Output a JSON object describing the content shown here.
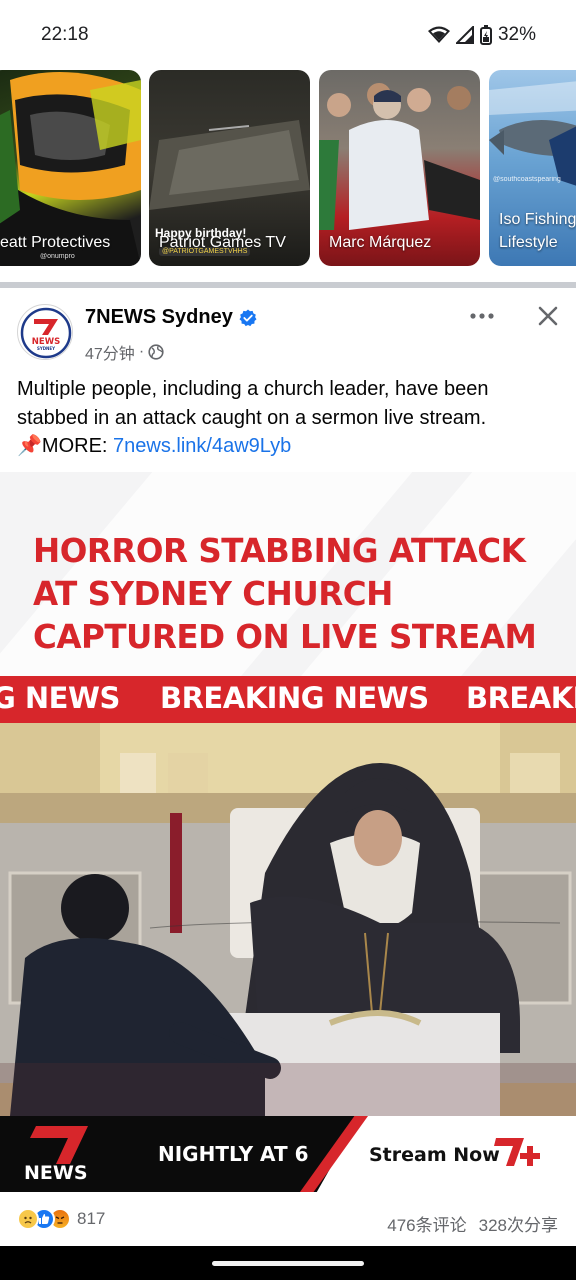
{
  "status_bar": {
    "time": "22:18",
    "battery": "32%"
  },
  "stories": [
    {
      "label": "eatt Protectives",
      "tag": "@onumpro"
    },
    {
      "label": "Patriot Games TV",
      "overlay": "Happy birthday!",
      "tag": "@PATRIOTGAMESTVHHS"
    },
    {
      "label": "Marc Márquez"
    },
    {
      "label_line1": "Iso Fishing",
      "label_line2": "Lifestyle",
      "tag": "@southcoastspearing"
    }
  ],
  "post": {
    "page_name": "7NEWS Sydney",
    "time": "47分钟",
    "separator": "·",
    "text_line1": "Multiple people, including a church leader, have been",
    "text_line2": "stabbed in an attack caught on a sermon live stream.",
    "text_more_prefix": "📌MORE: ",
    "link": "7news.link/4aw9Lyb",
    "image": {
      "headline_line1": "HORROR STABBING ATTACK",
      "headline_line2": "AT SYDNEY CHURCH",
      "headline_line3": "CAPTURED ON LIVE STREAM",
      "ticker_1": "G NEWS",
      "ticker_2": "BREAKING NEWS",
      "ticker_3": "BREAKI",
      "brand_news": "NEWS",
      "nightly": "NIGHTLY AT 6",
      "stream": "Stream Now"
    },
    "reactions_count": "817",
    "comments": "476条评论",
    "shares": "328次分享"
  },
  "colors": {
    "brand_red": "#d7262b",
    "link_blue": "#1a73e8",
    "verified_blue": "#1877f2"
  }
}
